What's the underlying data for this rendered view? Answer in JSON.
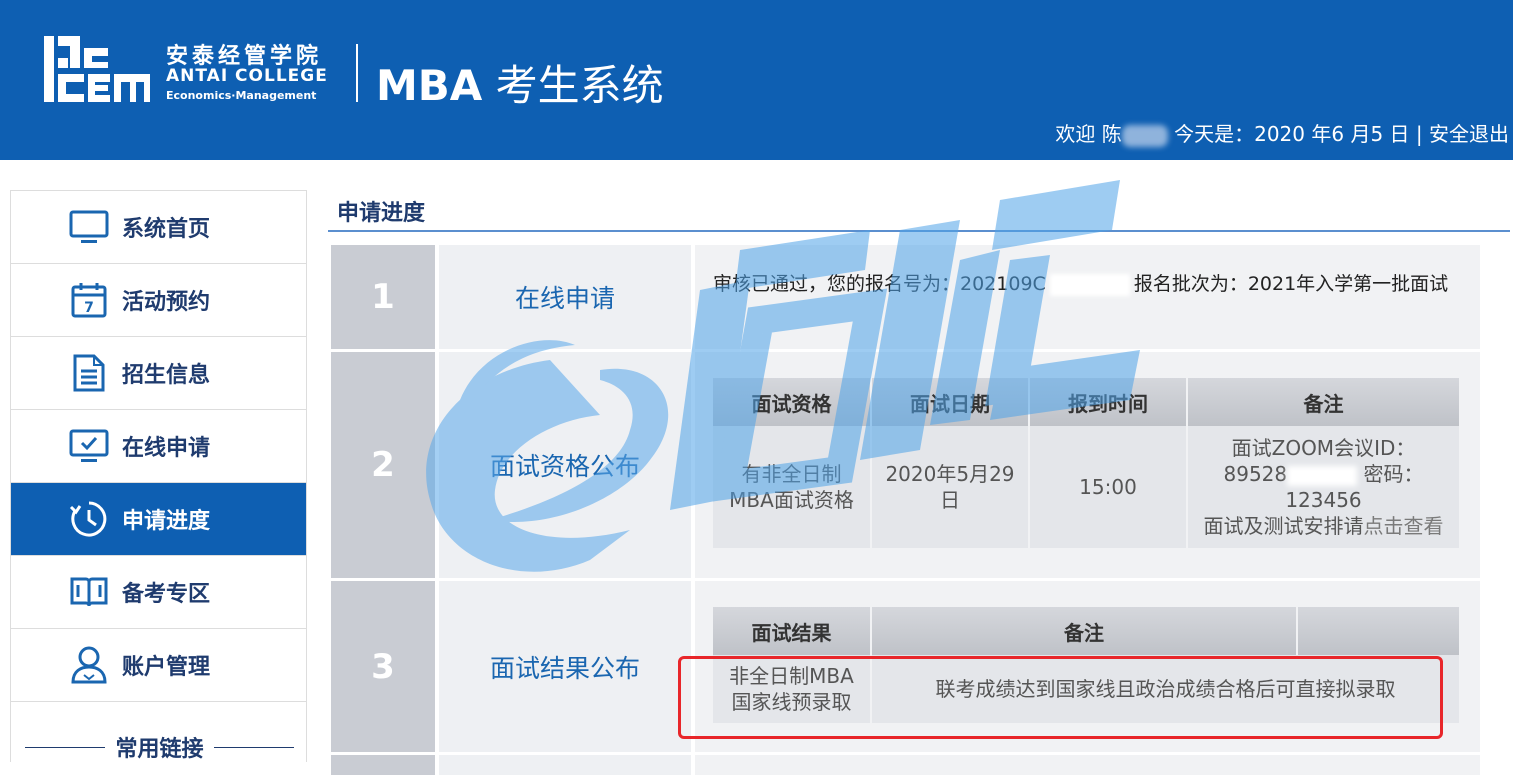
{
  "header": {
    "logo_cn": "安泰经管学院",
    "logo_en_line1": "ANTAI COLLEGE",
    "logo_en_line2": "Economics·Management",
    "system_title_prefix": "MBA",
    "system_title_suffix": " 考生系统",
    "welcome_prefix": "欢迎 陈",
    "date_text": "今天是：2020 年6 月5 日",
    "separator": "|",
    "logout": "安全退出"
  },
  "sidebar": {
    "items": [
      {
        "label": "系统首页",
        "icon": "monitor-icon"
      },
      {
        "label": "活动预约",
        "icon": "calendar-icon"
      },
      {
        "label": "招生信息",
        "icon": "document-icon"
      },
      {
        "label": "在线申请",
        "icon": "checked-monitor-icon"
      },
      {
        "label": "申请进度",
        "icon": "clock-icon",
        "active": true
      },
      {
        "label": "备考专区",
        "icon": "book-icon"
      },
      {
        "label": "账户管理",
        "icon": "user-icon"
      }
    ],
    "links_title": "常用链接"
  },
  "main": {
    "title": "申请进度",
    "steps": [
      {
        "num": "1",
        "name": "在线申请",
        "text_part1": "审核已通过，您的报名号为：202109C",
        "text_part2": "报名批次为：2021年入学第一批面试"
      },
      {
        "num": "2",
        "name": "面试资格公布",
        "headers": [
          "面试资格",
          "面试日期",
          "报到时间",
          "备注"
        ],
        "row": {
          "qualification": "有非全日制MBA面试资格",
          "date": "2020年5月29日",
          "time": "15:00",
          "note_line1": "面试ZOOM会议ID：",
          "note_id_prefix": "89528",
          "note_pwd_label": "密码：",
          "note_pwd": "123456",
          "note_link_prefix": "面试及测试安排请",
          "note_link": "点击查看"
        }
      },
      {
        "num": "3",
        "name": "面试结果公布",
        "headers": [
          "面试结果",
          "备注"
        ],
        "row": {
          "result": "非全日制MBA国家线预录取",
          "note": "联考成绩达到国家线且政治成绩合格后可直接拟录取"
        }
      }
    ]
  },
  "colors": {
    "brand_blue": "#0e5fb2",
    "highlight_red": "#e8262a"
  }
}
